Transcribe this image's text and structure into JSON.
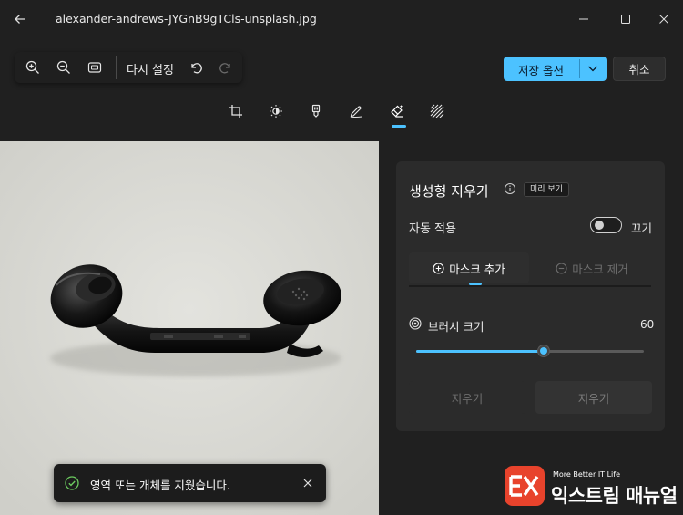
{
  "window": {
    "title": "alexander-andrews-JYGnB9gTCls-unsplash.jpg"
  },
  "toolbar": {
    "reset_label": "다시 설정",
    "save_label": "저장 옵션",
    "cancel_label": "취소"
  },
  "tools": [
    {
      "icon": "crop-icon"
    },
    {
      "icon": "adjust-brightness-icon"
    },
    {
      "icon": "filter-icon"
    },
    {
      "icon": "markup-icon"
    },
    {
      "icon": "erase-icon",
      "active": true
    },
    {
      "icon": "background-blur-icon"
    }
  ],
  "panel": {
    "title": "생성형 지우기",
    "preview_badge": "미리 보기",
    "auto_apply_label": "자동 적용",
    "auto_apply_state": "끄기",
    "mask_add_label": "마스크 추가",
    "mask_remove_label": "마스크 제거",
    "brush_label": "브러시 크기",
    "brush_value": "60",
    "brush_fraction": 0.56,
    "erase_label": "지우기",
    "erase_label_2": "지우기"
  },
  "toast": {
    "message": "영역 또는 개체를 지웠습니다."
  },
  "watermark": {
    "tagline": "More Better IT Life",
    "brand": "익스트림 매뉴얼"
  },
  "colors": {
    "accent": "#4cc2ff",
    "background": "#202020",
    "panel": "#2b2b2b",
    "watermark": "#e8432c"
  }
}
